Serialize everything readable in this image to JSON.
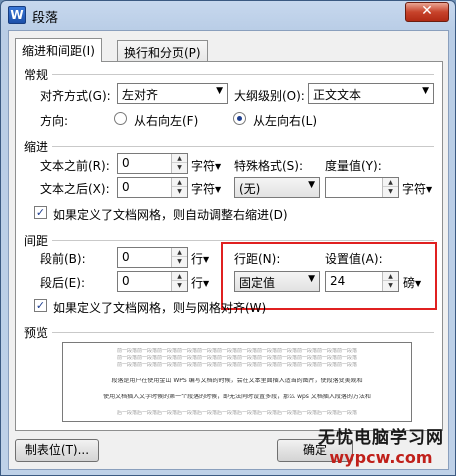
{
  "window": {
    "title": "段落",
    "app_icon_letter": "W",
    "close_symbol": "✕"
  },
  "tabs": [
    {
      "label": "缩进和间距(I)"
    },
    {
      "label": "换行和分页(P)"
    }
  ],
  "general": {
    "section": "常规",
    "alignment_label": "对齐方式(G):",
    "alignment_value": "左对齐",
    "outline_label": "大纲级别(O):",
    "outline_value": "正文文本",
    "direction_label": "方向:",
    "rtl_label": "从右向左(F)",
    "ltr_label": "从左向右(L)"
  },
  "indent": {
    "section": "缩进",
    "before_label": "文本之前(R):",
    "before_value": "0",
    "before_unit": "字符",
    "special_label": "特殊格式(S):",
    "special_value": "(无)",
    "measure_label": "度量值(Y):",
    "measure_value": "",
    "measure_unit": "字符",
    "after_label": "文本之后(X):",
    "after_value": "0",
    "after_unit": "字符",
    "grid_checkbox_label": "如果定义了文档网格，则自动调整右缩进(D)"
  },
  "spacing": {
    "section": "间距",
    "before_label": "段前(B):",
    "before_value": "0",
    "before_unit": "行",
    "after_label": "段后(E):",
    "after_value": "0",
    "after_unit": "行",
    "line_spacing_label": "行距(N):",
    "line_spacing_value": "固定值",
    "setting_label": "设置值(A):",
    "setting_value": "24",
    "setting_unit": "磅",
    "grid_checkbox_label": "如果定义了文档网格，则与网格对齐(W)"
  },
  "preview": {
    "section": "预览",
    "prev_para_text": "前一段落前一段落前一段落前一段落前一段落前一段落前一段落前一段落前一段落前一段落前一段落前一段落",
    "sample_line_1": "段落是用户在使用金山 WPS 编写文档的时候，会在文本里面插入适当的图片，使段落变美观和",
    "sample_line_2": "使用文档插入文字时候的第一个段落的时候，即无法同时设置多段，那么 wps 文档插入段落的方法和",
    "next_para_text": "后一段落后一段落后一段落后一段落后一段落后一段落后一段落后一段落后一段落后一段落后一段落后一段落"
  },
  "buttons": {
    "tabs": "制表位(T)...",
    "ok": "确定",
    "cancel": "取消"
  },
  "watermark": {
    "title": "无忧电脑学习网",
    "url": "wypcw.com"
  }
}
